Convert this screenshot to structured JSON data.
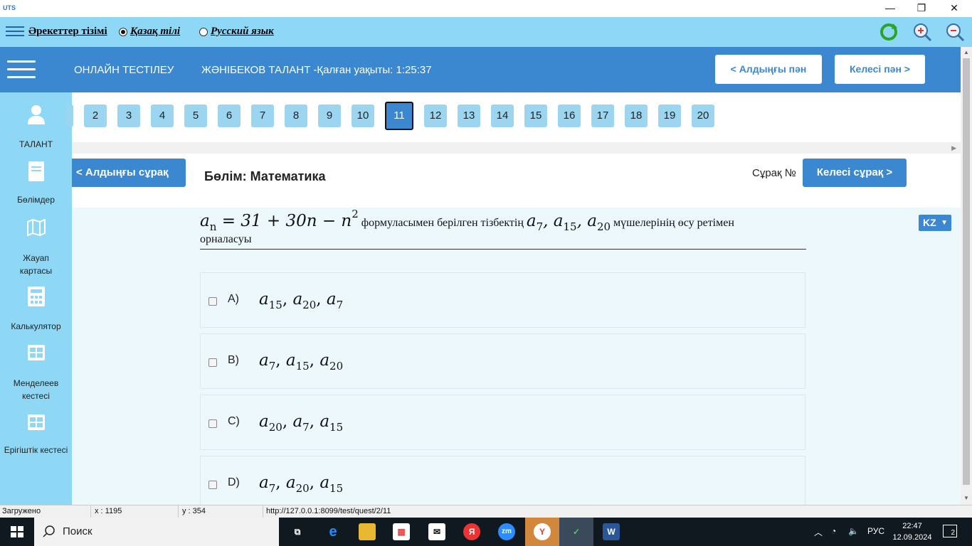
{
  "window": {
    "logo": "UTS",
    "minimize": "—",
    "restore": "❐",
    "close": "✕"
  },
  "toolbar": {
    "actions_list": "Әрекеттер тізімі",
    "lang_kazakh": "Қазақ тілі",
    "lang_russian": "Русский язык"
  },
  "header": {
    "title": "ОНЛАЙН ТЕСТІЛЕУ",
    "user_timer": "ЖӘНІБЕКОВ ТАЛАНТ -Қалған уақыты: 1:25:37",
    "prev_subject": "< Алдыңғы пән",
    "next_subject": "Келесі пән >"
  },
  "sidebar": {
    "items": [
      {
        "label": "ТАЛАНТ"
      },
      {
        "label": "Бөлімдер"
      },
      {
        "label": "Жауап картасы"
      },
      {
        "label": "Калькулятор"
      },
      {
        "label": "Менделеев кестесі"
      },
      {
        "label": "Ерігіштік кестесі"
      }
    ]
  },
  "question_numbers": [
    "2",
    "3",
    "4",
    "5",
    "6",
    "7",
    "8",
    "9",
    "10",
    "11",
    "12",
    "13",
    "14",
    "15",
    "16",
    "17",
    "18",
    "19",
    "20"
  ],
  "active_question": "11",
  "question_bar": {
    "prev_question": "< Алдыңғы сұрақ",
    "section": "Бөлім: Математика",
    "question_label": "Сұрақ №",
    "next_question": "Келесі сұрақ >"
  },
  "lang_select": "KZ",
  "question": {
    "text_part1": "формуласымен берілген тізбектің",
    "text_part2": "мүшелерінің өсу ретімен",
    "text_line2": "орналасуы"
  },
  "options": [
    {
      "letter": "A)",
      "terms": [
        "15",
        "20",
        "7"
      ]
    },
    {
      "letter": "B)",
      "terms": [
        "7",
        "15",
        "20"
      ]
    },
    {
      "letter": "C)",
      "terms": [
        "20",
        "7",
        "15"
      ]
    },
    {
      "letter": "D)",
      "terms": [
        "7",
        "20",
        "15"
      ]
    }
  ],
  "status": {
    "state": "Загружено",
    "x": "x : 1195",
    "y": "y : 354",
    "url": "http://127.0.0.1:8099/test/quest/2/11"
  },
  "taskbar": {
    "search": "Поиск",
    "lang": "РУС",
    "time": "22:47",
    "date": "12.09.2024",
    "notifications": "2"
  }
}
